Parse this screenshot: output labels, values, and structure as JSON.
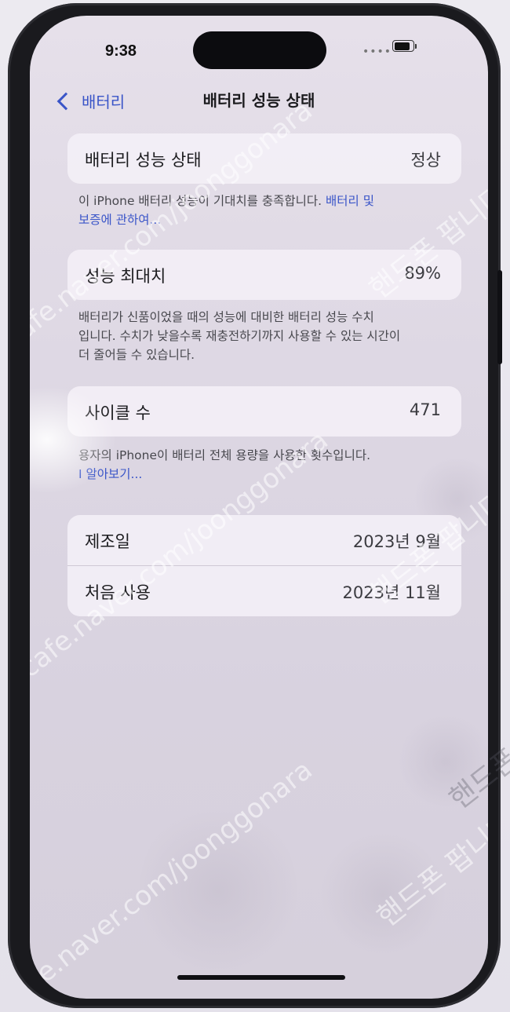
{
  "status_bar": {
    "time": "9:38",
    "signal": "••••",
    "battery_level": 0.85
  },
  "nav": {
    "back_label": "배터리",
    "title": "배터리 성능 상태"
  },
  "health": {
    "label": "배터리 성능 상태",
    "value": "정상",
    "footnote": "이 iPhone 배터리 성능이 기대치를 충족합니다.",
    "footnote_link_line1": "배터리 및",
    "footnote_link_line2": "보증에 관하여..."
  },
  "max_capacity": {
    "label": "성능 최대치",
    "value": "89%",
    "footnote_line1": "배터리가 신품이었을 때의 성능에 대비한 배터리 성능 수치",
    "footnote_line2": "입니다. 수치가 낮을수록 재충전하기까지 사용할 수 있는 시간이",
    "footnote_line3": "더 줄어들 수 있습니다."
  },
  "cycle_count": {
    "label": "사이클 수",
    "value": "471",
    "footnote": "용자의 iPhone이 배터리 전체 용량을 사용한 횟수입니다.",
    "link": "I 알아보기..."
  },
  "dates": {
    "manufacture_label": "제조일",
    "manufacture_value": "2023년 9월",
    "first_use_label": "처음 사용",
    "first_use_value": "2023년 11월"
  },
  "watermarks": {
    "site_1": "cafe.naver.com/joonggonara",
    "site_2": "cafe.naver.com/joonggonara",
    "site_3": "cafe.naver.com/joonggonara",
    "brand_1": "핸드폰 팝니다",
    "brand_2": "핸드폰 팝니다",
    "brand_3": "핸드폰 팝니다",
    "brand_4": "핸드폰 팝니다"
  },
  "colors": {
    "accent": "#3a55c8",
    "screen_bg": "#e2dce6",
    "frame": "#1a1a1e"
  }
}
